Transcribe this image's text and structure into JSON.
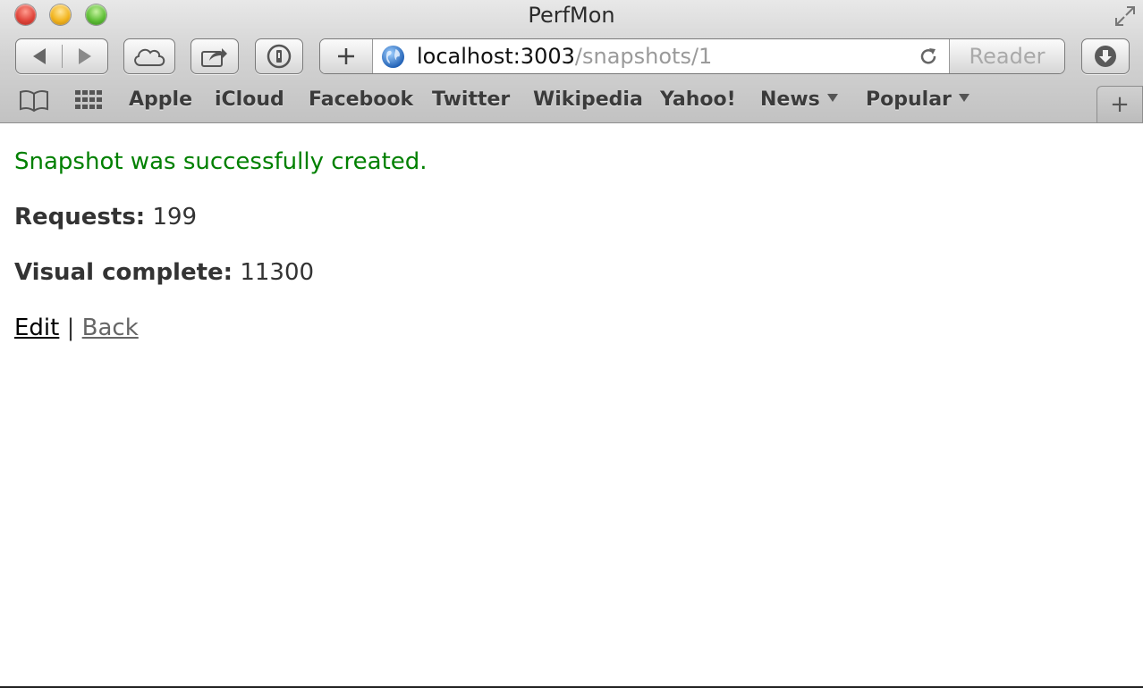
{
  "window": {
    "title": "PerfMon"
  },
  "toolbar": {
    "url_host": "localhost:3003",
    "url_path": "/snapshots/1",
    "reader_label": "Reader",
    "icons": [
      "back-arrow-icon",
      "forward-arrow-icon",
      "icloud-icon",
      "share-icon",
      "password-icon",
      "plus-icon",
      "globe-icon",
      "reload-icon",
      "download-icon"
    ]
  },
  "bookmarks": {
    "items": [
      {
        "label": "Apple"
      },
      {
        "label": "iCloud"
      },
      {
        "label": "Facebook"
      },
      {
        "label": "Twitter"
      },
      {
        "label": "Wikipedia"
      },
      {
        "label": "Yahoo!"
      },
      {
        "label": "News"
      },
      {
        "label": "Popular"
      }
    ],
    "new_tab_label": "+"
  },
  "page": {
    "notice": "Snapshot was successfully created.",
    "requests_label": "Requests:",
    "requests_value": "199",
    "visual_label": "Visual complete:",
    "visual_value": "11300",
    "edit_link": "Edit",
    "separator": "|",
    "back_link": "Back"
  },
  "colors": {
    "notice": "#008000",
    "text": "#333333",
    "visited_link": "#666666"
  }
}
